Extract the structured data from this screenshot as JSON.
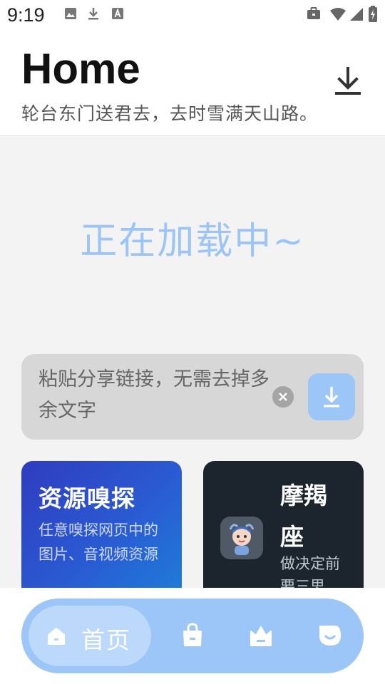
{
  "status_bar": {
    "time": "9:19",
    "left_icons": [
      "image-icon",
      "download-icon",
      "font-icon"
    ],
    "right_icons": [
      "briefcase-icon",
      "wifi-icon",
      "signal-icon",
      "battery-icon"
    ]
  },
  "header": {
    "title": "Home",
    "subtitle": "轮台东门送君去，去时雪满天山路。",
    "action_icon": "download-icon"
  },
  "main": {
    "loading_text": "正在加载中~",
    "link_input": {
      "placeholder": "粘贴分享链接，无需去掉多余文字",
      "value": ""
    }
  },
  "cards": [
    {
      "title": "资源嗅探",
      "description": "任意嗅探网页中的图片、音视频资源"
    },
    {
      "title": "摩羯座",
      "description": "做决定前要三思"
    }
  ],
  "bottom_nav": {
    "items": [
      {
        "label": "首页",
        "icon": "home-icon",
        "active": true
      },
      {
        "label": "",
        "icon": "shopping-bag-icon",
        "active": false
      },
      {
        "label": "",
        "icon": "crown-icon",
        "active": false
      },
      {
        "label": "",
        "icon": "profile-icon",
        "active": false
      }
    ]
  },
  "colors": {
    "accent": "#9cc6f7",
    "accent_light": "#bcd9fb",
    "loading": "#9cc4f7",
    "card_sniff": "#2a5bd3",
    "card_moji": "#1c252e"
  }
}
